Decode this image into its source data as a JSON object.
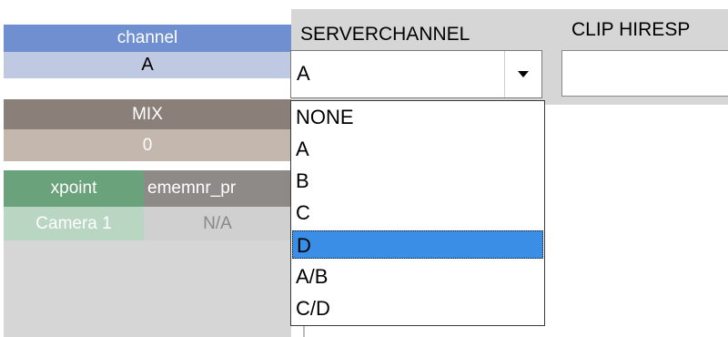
{
  "left_table": {
    "channel_header": "channel",
    "channel_value": "A",
    "mix_header": "MIX",
    "mix_value": "0",
    "xpoint_header": "xpoint",
    "ememnr_header": "ememnr_pr",
    "xpoint_value": "Camera 1",
    "ememnr_value": "N/A"
  },
  "columns": {
    "serverchannel_label": "SERVERCHANNEL",
    "clip_label": "CLIP HIRESP"
  },
  "serverchannel_combo": {
    "selected_value": "A",
    "icon": "chevron-down-icon"
  },
  "dropdown": {
    "options": [
      "NONE",
      "A",
      "B",
      "C",
      "D",
      "A/B",
      "C/D"
    ],
    "highlighted": "D"
  },
  "colors": {
    "channel_header": "#6f8fd0",
    "selection": "#3a8ee6",
    "mix_header": "#8b7f79",
    "xpoint_header": "#6aa27c"
  }
}
